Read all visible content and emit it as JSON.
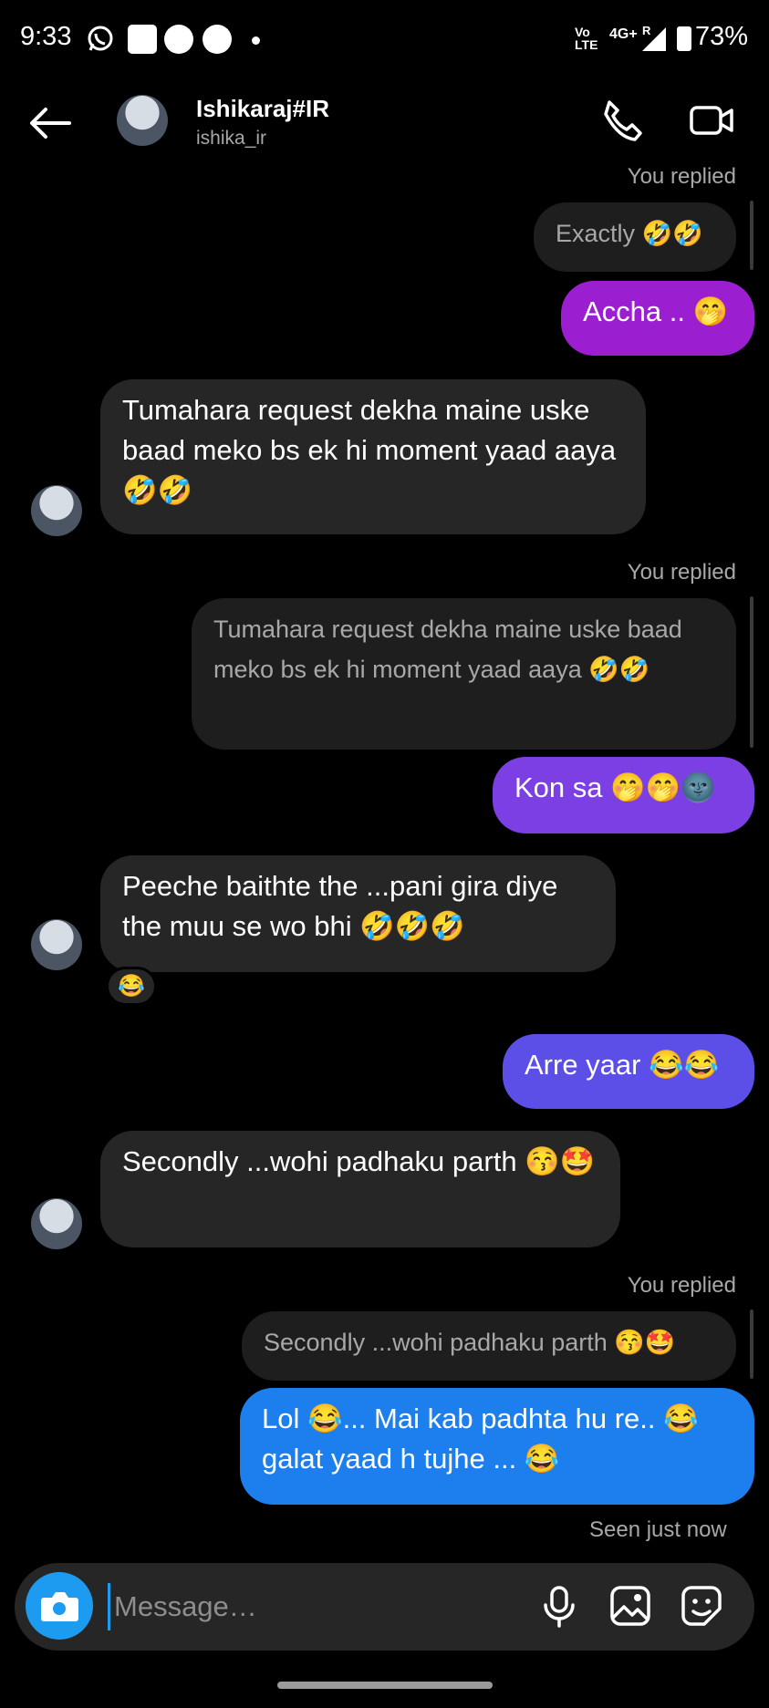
{
  "status_bar": {
    "time": "9:33",
    "network_volte": "Vo LTE",
    "network_type": "4G+",
    "roaming": "R",
    "battery": "73%"
  },
  "header": {
    "display_name": "Ishikaraj#IR",
    "username": "ishika_ir",
    "icons": [
      "back-arrow-icon",
      "phone-icon",
      "video-icon"
    ]
  },
  "messages": {
    "r1_label": "You replied",
    "r1_quote": "Exactly 🤣🤣",
    "s1": "Accha .. 🤭",
    "m1": "Tumahara request dekha maine uske baad meko bs ek hi moment yaad aaya 🤣🤣",
    "r2_label": "You replied",
    "r2_quote": "Tumahara request dekha maine uske baad meko bs ek hi moment yaad aaya 🤣🤣",
    "s2": "Kon sa 🤭🤭🌚",
    "m2": "Peeche baithte the ...pani gira diye the muu se wo bhi 🤣🤣🤣",
    "m2_reaction": "😂",
    "s3": "Arre yaar 😂😂",
    "m3": "Secondly ...wohi padhaku parth 😚🤩",
    "r3_label": "You replied",
    "r3_quote": "Secondly ...wohi padhaku parth 😚🤩",
    "s4": "Lol 😂... Mai kab padhta hu re.. 😂 galat yaad h tujhe ... 😂",
    "seen": "Seen just now"
  },
  "composer": {
    "placeholder": "Message…",
    "icons": [
      "camera-icon",
      "microphone-icon",
      "gallery-icon",
      "sticker-icon"
    ]
  },
  "colors": {
    "background": "#000000",
    "received_bubble": "#262626",
    "accent": "#1d9bf0",
    "sent_gradient": [
      "#9b1fd0",
      "#7b3fe4",
      "#5b4fe8",
      "#2a6fe8",
      "#1d8af0"
    ]
  }
}
